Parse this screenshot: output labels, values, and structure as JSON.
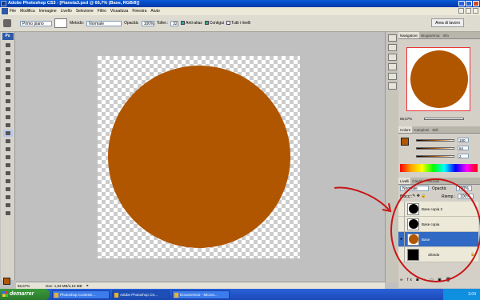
{
  "window": {
    "title": "Adobe Photoshop CS3 - [Pianeta3.psd @ 66,7% (Base, RGB/8)]"
  },
  "menu": [
    "File",
    "Modifica",
    "Immagine",
    "Livello",
    "Selezione",
    "Filtro",
    "Visualizza",
    "Finestra",
    "Aiuto"
  ],
  "options": {
    "sample_value": "Primo piano",
    "mode_label": "Metodo:",
    "mode_value": "Normale",
    "opacity_label": "Opacità:",
    "opacity_value": "100%",
    "tolerance_label": "Toller.:",
    "tolerance_value": "32",
    "antialias_label": "Anti-alias",
    "contiguous_label": "Contigui",
    "all_layers_label": "Tutti i livelli",
    "workspace_label": "Area di lavoro"
  },
  "status": {
    "zoom": "66,67%",
    "doc": "Doc: 1,83 MB/4,16 MB"
  },
  "navigator": {
    "tabs": [
      "Navigatore",
      "Istogramma",
      "Info"
    ],
    "zoom": "66,67%"
  },
  "color": {
    "tabs": [
      "Colore",
      "Campioni",
      "Stili"
    ],
    "r": "180",
    "g": "84",
    "b": "2"
  },
  "layers": {
    "tabs": [
      "Livelli",
      "Canali",
      "Tracciati"
    ],
    "blend": "Normale",
    "opacity_label": "Opacità:",
    "opacity_value": "100%",
    "lock_label": "Blocc.:",
    "fill_label": "Riemp.:",
    "fill_value": "100%",
    "items": [
      {
        "name": "Base copia 2"
      },
      {
        "name": "Base copia"
      },
      {
        "name": "Base"
      },
      {
        "name": "Sfondo"
      }
    ]
  },
  "taskbar": {
    "start": "demarrer",
    "items": [
      "Photoshop Contests ...",
      "Adobe Photoshop CS...",
      "Documento2 - Micros..."
    ],
    "clock": "3.04"
  },
  "colors": {
    "planet": "#b15600",
    "annotation": "#c81414"
  }
}
